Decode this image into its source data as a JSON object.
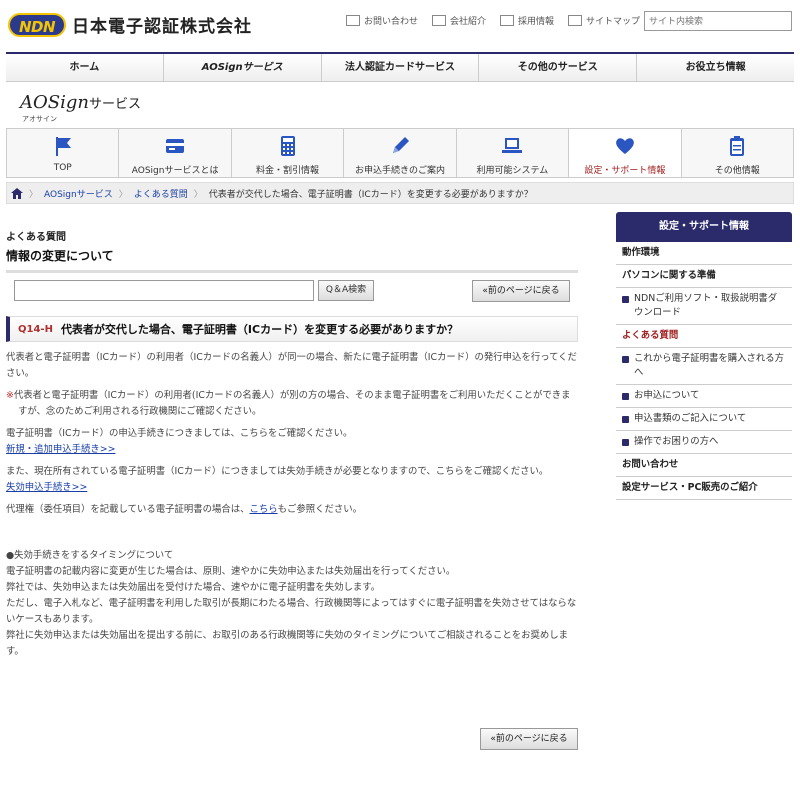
{
  "header": {
    "logo_badge": "NDN",
    "company_name": "日本電子認証株式会社",
    "utility": [
      "お問い合わせ",
      "会社紹介",
      "採用情報",
      "サイトマップ"
    ],
    "search_placeholder": "サイト内検索"
  },
  "global_nav": [
    "ホーム",
    "AOSignサービス",
    "法人認証カードサービス",
    "その他のサービス",
    "お役立ち情報"
  ],
  "service": {
    "title": "AOSign",
    "suffix": "サービス",
    "reading": "アオサイン"
  },
  "sub_nav": [
    {
      "label": "TOP",
      "icon": "flag-icon"
    },
    {
      "label": "AOSignサービスとは",
      "icon": "card-icon"
    },
    {
      "label": "料金・割引情報",
      "icon": "calculator-icon"
    },
    {
      "label": "お申込手続きのご案内",
      "icon": "pen-icon"
    },
    {
      "label": "利用可能システム",
      "icon": "laptop-icon"
    },
    {
      "label": "設定・サポート情報",
      "icon": "heart-icon"
    },
    {
      "label": "その他情報",
      "icon": "clipboard-icon"
    }
  ],
  "breadcrumb": [
    "AOSignサービス",
    "よくある質問",
    "代表者が交代した場合、電子証明書（ICカード）を変更する必要がありますか？"
  ],
  "main": {
    "faq_label": "よくある質問",
    "faq_title": "情報の変更について",
    "qa_button": "Q＆A検索",
    "back_button": "«前のページに戻る",
    "q_code": "Q14-H",
    "q_text": "代表者が交代した場合、電子証明書（ICカード）を変更する必要がありますか？",
    "p1": "代表者と電子証明書（ICカード）の利用者（ICカードの名義人）が同一の場合、新たに電子証明書（ICカード）の発行申込を行ってください。",
    "note_mark": "※",
    "note": "代表者と電子証明書（ICカード）の利用者(ICカードの名義人）が別の方の場合、そのまま電子証明書をご利用いただくことができますが、念のためご利用される行政機関にご確認ください。",
    "p2": "電子証明書（ICカード）の申込手続きにつきましては、こちらをご確認ください。",
    "link1": "新規・追加申込手続き>>",
    "p3": "また、現在所有されている電子証明書（ICカード）につきましては失効手続きが必要となりますので、こちらをご確認ください。",
    "link2": "失効申込手続き>>",
    "p4_pre": "代理権（委任項目）を記載している電子証明書の場合は、",
    "p4_link": "こちら",
    "p4_post": "もご参照ください。",
    "timing_title": "●失効手続きをするタイミングについて",
    "timing_1": "電子証明書の記載内容に変更が生じた場合は、原則、速やかに失効申込または失効届出を行ってください。",
    "timing_2": "弊社では、失効申込または失効届出を受付けた場合、速やかに電子証明書を失効します。",
    "timing_3": "ただし、電子入札など、電子証明書を利用した取引が長期にわたる場合、行政機関等によってはすぐに電子証明書を失効させてはならないケースもあります。",
    "timing_4": "弊社に失効申込または失効届出を提出する前に、お取引のある行政機関等に失効のタイミングについてご相談されることをお奨めします。"
  },
  "side": {
    "head": "設定・サポート情報",
    "items": [
      {
        "label": "動作環境",
        "type": "bold"
      },
      {
        "label": "パソコンに関する準備",
        "type": "bold"
      },
      {
        "label": "NDNご利用ソフト・取扱説明書ダウンロード",
        "type": "sub"
      },
      {
        "label": "よくある質問",
        "type": "active"
      },
      {
        "label": "これから電子証明書を購入される方へ",
        "type": "sub"
      },
      {
        "label": "お申込について",
        "type": "sub"
      },
      {
        "label": "申込書類のご記入について",
        "type": "sub"
      },
      {
        "label": "操作でお困りの方へ",
        "type": "sub"
      },
      {
        "label": "お問い合わせ",
        "type": "bold"
      },
      {
        "label": "設定サービス・PC販売のご紹介",
        "type": "bold"
      }
    ]
  },
  "colors": {
    "brand_navy": "#2b2a6b",
    "accent_red": "#a02020"
  }
}
